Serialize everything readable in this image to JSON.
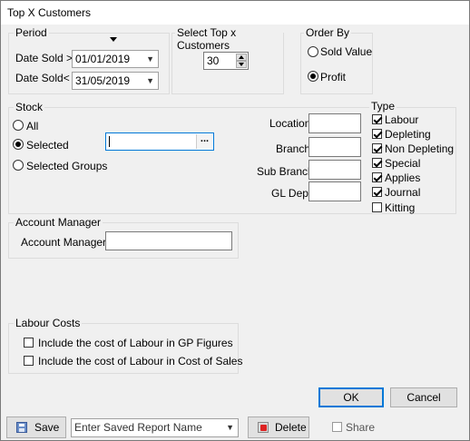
{
  "window": {
    "title": "Top X Customers"
  },
  "period": {
    "legend": "Period",
    "date_sold_from_label": "Date Sold >",
    "date_sold_from_value": "01/01/2019",
    "date_sold_to_label": "Date Sold<",
    "date_sold_to_value": "31/05/2019"
  },
  "top_x": {
    "legend": "Select Top x Customers",
    "value": "30"
  },
  "order_by": {
    "legend": "Order By",
    "options": [
      "Sold Value",
      "Profit"
    ],
    "selected": "Profit"
  },
  "stock": {
    "legend": "Stock",
    "options": [
      "All",
      "Selected",
      "Selected Groups"
    ],
    "selected": "Selected",
    "selected_value": "",
    "browse_label": "...",
    "location_label": "Location",
    "branch_label": "Branch",
    "sub_branch_label": "Sub Branch",
    "gl_dept_label": "GL Dept"
  },
  "type": {
    "legend": "Type",
    "items": [
      {
        "label": "Labour",
        "checked": true
      },
      {
        "label": "Depleting",
        "checked": true
      },
      {
        "label": "Non Depleting",
        "checked": true
      },
      {
        "label": "Special",
        "checked": true
      },
      {
        "label": "Applies",
        "checked": true
      },
      {
        "label": "Journal",
        "checked": true
      },
      {
        "label": "Kitting",
        "checked": false
      }
    ]
  },
  "account_manager": {
    "legend": "Account Manager",
    "label": "Account Manager",
    "value": ""
  },
  "labour_costs": {
    "legend": "Labour Costs",
    "gp_label": "Include the cost of Labour in GP Figures",
    "gp_checked": false,
    "cos_label": "Include the cost of Labour in Cost of Sales",
    "cos_checked": false
  },
  "buttons": {
    "ok": "OK",
    "cancel": "Cancel",
    "save": "Save",
    "delete": "Delete"
  },
  "saved_report": {
    "placeholder": "Enter Saved Report Name"
  },
  "share": {
    "label": "Share",
    "checked": false
  }
}
